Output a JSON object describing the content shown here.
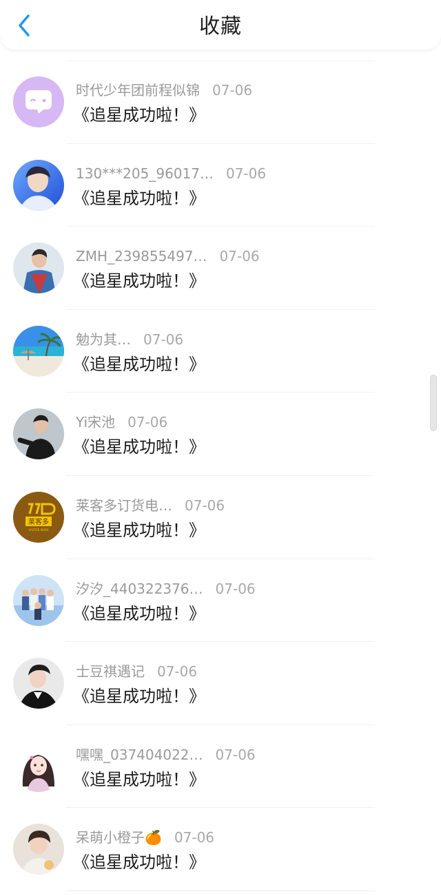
{
  "header": {
    "title": "收藏",
    "back_icon": "back-arrow-icon",
    "accent": "#2196f3"
  },
  "list": {
    "items": [
      {
        "name": "时代少年团前程似锦",
        "time": "07-06",
        "message": "《追星成功啦！》",
        "avatar": "chat-bubble-logo"
      },
      {
        "name": "130***205_96017…",
        "time": "07-06",
        "message": "《追星成功啦！》",
        "avatar": "photo-portrait"
      },
      {
        "name": "ZMH_239855497…",
        "time": "07-06",
        "message": "《追星成功啦！》",
        "avatar": "photo-portrait"
      },
      {
        "name": "勉为其…",
        "time": "07-06",
        "message": "《追星成功啦！》",
        "avatar": "photo-beach"
      },
      {
        "name": "Yi宋池",
        "time": "07-06",
        "message": "《追星成功啦！》",
        "avatar": "photo-portrait"
      },
      {
        "name": "莱客多订货电…",
        "time": "07-06",
        "message": "《追星成功啦！》",
        "avatar": "brand-logo",
        "logo_text": "莱客多",
        "logo_sub": "VISITOR MORE"
      },
      {
        "name": "汐汐_440322376…",
        "time": "07-06",
        "message": "《追星成功啦！》",
        "avatar": "photo-group"
      },
      {
        "name": "士豆祺遇记",
        "time": "07-06",
        "message": "《追星成功啦！》",
        "avatar": "photo-portrait"
      },
      {
        "name": "嘿嘿_037404022…",
        "time": "07-06",
        "message": "《追星成功啦！》",
        "avatar": "photo-illustration"
      },
      {
        "name": "呆萌小橙子🍊",
        "time": "07-06",
        "message": "《追星成功啦！》",
        "avatar": "photo-portrait"
      }
    ]
  }
}
